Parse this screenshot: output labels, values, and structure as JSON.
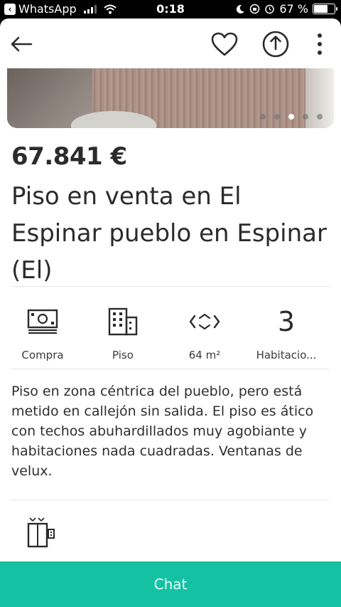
{
  "status_bar": {
    "app_back": "WhatsApp",
    "time": "0:18",
    "battery": "67 %",
    "battery_level": 0.67
  },
  "listing": {
    "price": "67.841 €",
    "title": "Piso en venta en El Espinar pueblo en Espinar (El)",
    "photo_count": 5,
    "active_photo_index": 2
  },
  "features": [
    {
      "icon": "money-icon",
      "label": "Compra"
    },
    {
      "icon": "building-icon",
      "label": "Piso"
    },
    {
      "icon": "area-arrows-icon",
      "label": "64 m²"
    },
    {
      "value": "3",
      "label": "Habitacio..."
    }
  ],
  "description": "Piso en zona céntrica del pueblo, pero está metido en callejón sin salida. El piso es ático con techos abuhardillados muy agobiante y habitaciones nada cuadradas. Ventanas de velux.",
  "chat_button": {
    "label": "Chat"
  },
  "colors": {
    "accent": "#14c1a3",
    "text": "#2b2b2b"
  }
}
